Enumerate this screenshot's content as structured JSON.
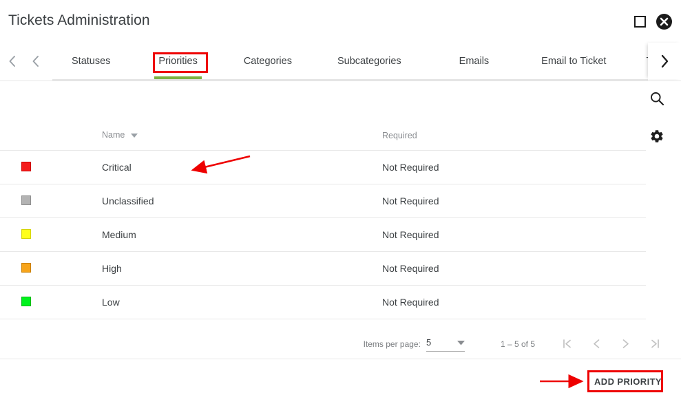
{
  "window": {
    "title": "Tickets Administration",
    "maximize_icon": "square-maximize-icon",
    "close_icon": "close-circle-icon"
  },
  "tabbar": {
    "nav_first_icon": "chevron-left-icon",
    "nav_prev_icon": "chevron-left-icon",
    "nav_next_icon": "chevron-right-icon",
    "active_tab": "Priorities",
    "active_underline_color": "#7cb342",
    "tabs": [
      {
        "label": "Statuses",
        "active": false
      },
      {
        "label": "Priorities",
        "active": true
      },
      {
        "label": "Categories",
        "active": false
      },
      {
        "label": "Subcategories",
        "active": false
      },
      {
        "label": "Emails",
        "active": false
      },
      {
        "label": "Email to Ticket",
        "active": false
      },
      {
        "label": "Text to Ticket",
        "active": false
      }
    ]
  },
  "side_actions": [
    {
      "name": "search-icon",
      "label": "Search"
    },
    {
      "name": "gear-icon",
      "label": "Settings"
    }
  ],
  "table": {
    "columns": [
      {
        "key": "color",
        "label": ""
      },
      {
        "key": "name",
        "label": "Name",
        "sorted": true,
        "sort_icon": "sort-descending-arrow"
      },
      {
        "key": "required",
        "label": "Required"
      }
    ],
    "rows": [
      {
        "color": "#f41d1d",
        "border": "#cc0000",
        "name": "Critical",
        "required": "Not Required"
      },
      {
        "color": "#b3b3b3",
        "border": "#8f8f8f",
        "name": "Unclassified",
        "required": "Not Required"
      },
      {
        "color": "#ffff1a",
        "border": "#d4d400",
        "name": "Medium",
        "required": "Not Required"
      },
      {
        "color": "#f7a41a",
        "border": "#c97f00",
        "name": "High",
        "required": "Not Required"
      },
      {
        "color": "#00f21d",
        "border": "#00b816",
        "name": "Low",
        "required": "Not Required"
      }
    ]
  },
  "paginator": {
    "items_per_page_label": "Items per page:",
    "items_per_page_value": "5",
    "dropdown_icon": "chevron-down-icon",
    "range_label": "1 – 5 of 5",
    "buttons": [
      {
        "name": "first-page-button",
        "icon": "first-page-icon",
        "disabled": true
      },
      {
        "name": "previous-page-button",
        "icon": "chevron-left-icon",
        "disabled": true
      },
      {
        "name": "next-page-button",
        "icon": "chevron-right-icon",
        "disabled": true
      },
      {
        "name": "last-page-button",
        "icon": "last-page-icon",
        "disabled": true
      }
    ]
  },
  "footer": {
    "add_button_label": "ADD PRIORITY"
  },
  "annotations": {
    "color": "#ee0000",
    "highlight_tab": "Priorities",
    "highlight_button": "ADD PRIORITY",
    "arrow_to_table": "red-arrow-pointing-to-critical-row",
    "arrow_to_add_button": "red-arrow-pointing-to-add-priority-button"
  }
}
